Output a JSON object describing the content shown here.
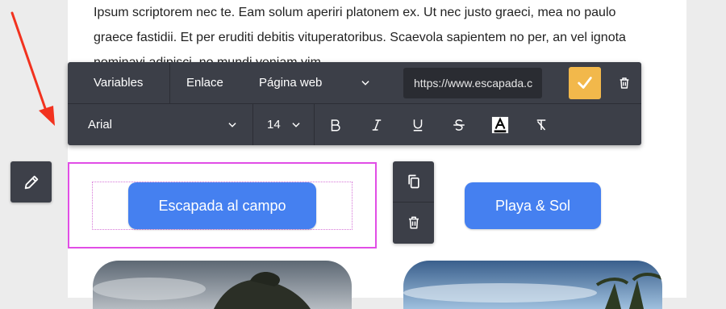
{
  "paragraph": {
    "line1": "Ipsum scriptorem nec te. Eam solum aperiri platonem ex. Ut nec justo graeci, mea no paulo",
    "line2": "graece fastidii. Et per eruditi debitis vituperatoribus. Scaevola sapientem no per, an vel ignota",
    "line3": "nominavi adipisci, no mundi veniam vim."
  },
  "toolbar": {
    "variables_label": "Variables",
    "link_label": "Enlace",
    "link_type": "Página web",
    "url_value": "https://www.escapada.c",
    "font_family": "Arial",
    "font_size": "14",
    "icons": {
      "confirm": "check-icon",
      "delete": "trash-icon",
      "bold": "bold-icon",
      "italic": "italic-icon",
      "underline": "underline-icon",
      "strikethrough": "strikethrough-icon",
      "text_color": "text-color-icon",
      "clear_format": "clear-format-icon"
    }
  },
  "buttons": {
    "button1_label": "Escapada al campo",
    "button2_label": "Playa & Sol"
  },
  "colors": {
    "accent_blue": "#4580f0",
    "confirm_yellow": "#f2b84b",
    "selection_magenta": "#e14ee6",
    "toolbar_dark": "#3c3f48",
    "arrow_red": "#f2321f"
  }
}
